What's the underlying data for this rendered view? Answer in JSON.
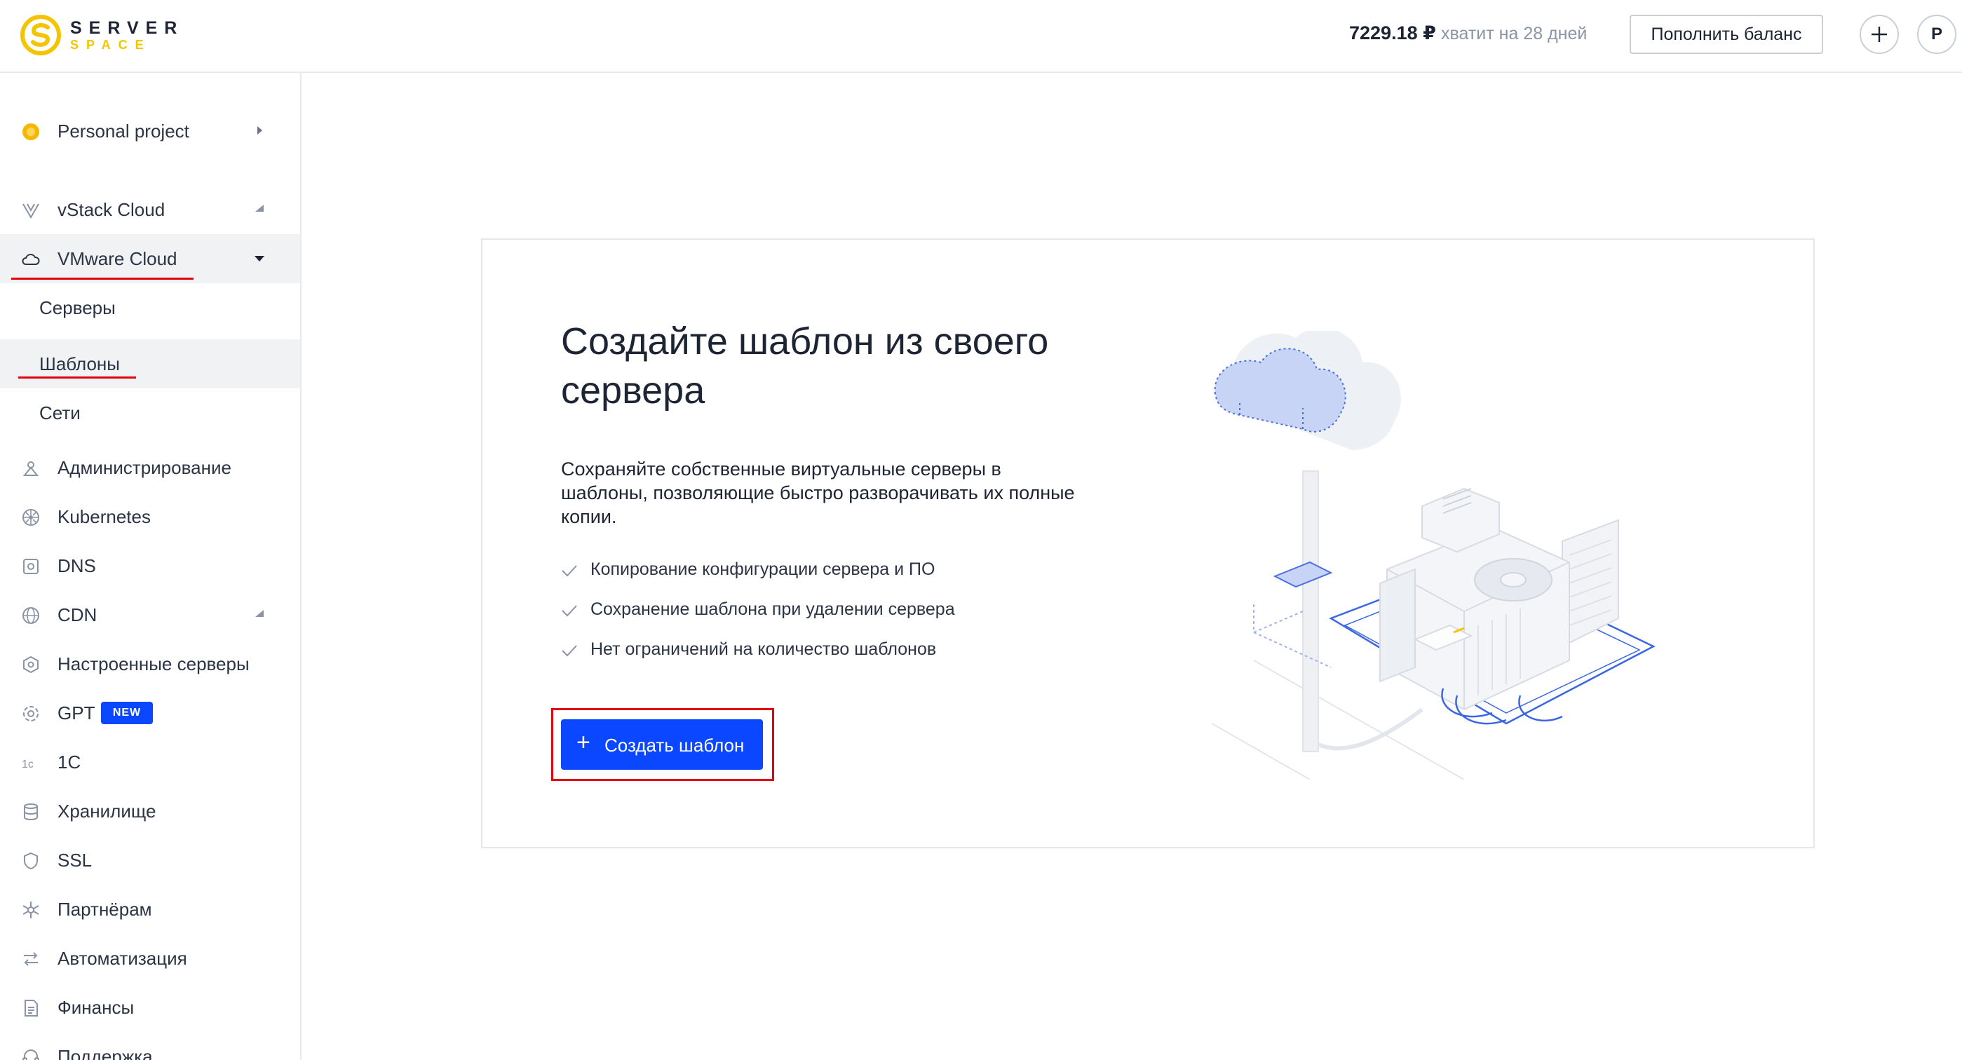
{
  "brand": {
    "word1": "SERVER",
    "word2": "SPACE",
    "accent_color": "#F5C400"
  },
  "header": {
    "balance": "7229.18 ₽",
    "balance_days": "хватит на 28 дней",
    "topup_label": "Пополнить баланс",
    "add_icon": "plus-icon",
    "avatar_letter": "P"
  },
  "sidebar": {
    "project": {
      "label": "Personal project",
      "icon": "project-dot-icon"
    },
    "items": [
      {
        "label": "vStack Cloud",
        "icon": "vstack-icon",
        "arrow": "up"
      },
      {
        "label": "VMware Cloud",
        "icon": "cloud-icon",
        "arrow": "down",
        "active": true
      },
      {
        "label": "Администрирование",
        "icon": "admin-icon"
      },
      {
        "label": "Kubernetes",
        "icon": "kubernetes-icon"
      },
      {
        "label": "DNS",
        "icon": "dns-icon"
      },
      {
        "label": "CDN",
        "icon": "globe-icon",
        "arrow": "up"
      },
      {
        "label": "Настроенные серверы",
        "icon": "configured-servers-icon"
      },
      {
        "label": "GPT",
        "icon": "gpt-icon",
        "badge": "NEW"
      },
      {
        "label": "1C",
        "icon": "1c-icon"
      },
      {
        "label": "Хранилище",
        "icon": "storage-icon"
      },
      {
        "label": "SSL",
        "icon": "shield-icon"
      },
      {
        "label": "Партнёрам",
        "icon": "partners-icon"
      },
      {
        "label": "Автоматизация",
        "icon": "automation-icon"
      },
      {
        "label": "Финансы",
        "icon": "finance-icon"
      },
      {
        "label": "Поддержка",
        "icon": "support-icon"
      }
    ],
    "vmware_sub": [
      {
        "label": "Серверы"
      },
      {
        "label": "Шаблоны",
        "active": true
      },
      {
        "label": "Сети"
      }
    ]
  },
  "main": {
    "title": "Создайте шаблон из своего сервера",
    "description": "Сохраняйте собственные виртуальные серверы в шаблоны, позволяющие быстро разворачивать их полные копии.",
    "features": [
      "Копирование конфигурации сервера и ПО",
      "Сохранение шаблона при удалении сервера",
      "Нет ограничений на количество шаблонов"
    ],
    "create_button": "Создать шаблон",
    "illustration": "cloud-server-illustration"
  },
  "colors": {
    "primary": "#0A47FF",
    "highlight": "#E3000F",
    "text": "#1D2433",
    "muted": "#8A94A6"
  }
}
